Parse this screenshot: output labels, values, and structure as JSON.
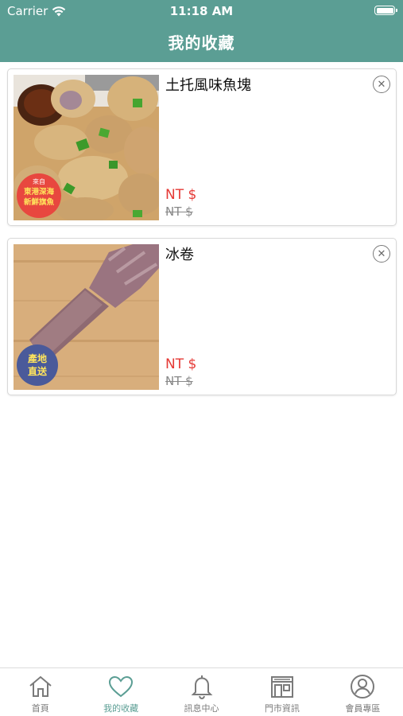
{
  "status_bar": {
    "carrier": "Carrier",
    "time": "11:18 AM"
  },
  "header": {
    "title": "我的收藏"
  },
  "favorites": [
    {
      "name": "土托風味魚塊",
      "price": "NT $",
      "original_price": "NT $",
      "badge_line1": "來自",
      "badge_line2": "東港深海",
      "badge_line3": "新鮮旗魚"
    },
    {
      "name": "冰卷",
      "price": "NT $",
      "original_price": "NT $",
      "badge_line1": "產地",
      "badge_line2": "直送"
    }
  ],
  "tabbar": {
    "items": [
      {
        "label": "首頁",
        "icon": "home-icon"
      },
      {
        "label": "我的收藏",
        "icon": "heart-icon"
      },
      {
        "label": "訊息中心",
        "icon": "bell-icon"
      },
      {
        "label": "門市資訊",
        "icon": "store-icon"
      },
      {
        "label": "會員專區",
        "icon": "user-icon"
      }
    ],
    "active_index": 1
  },
  "colors": {
    "brand": "#5b9e94",
    "price": "#e53935",
    "inactive": "#7a7a7a"
  }
}
